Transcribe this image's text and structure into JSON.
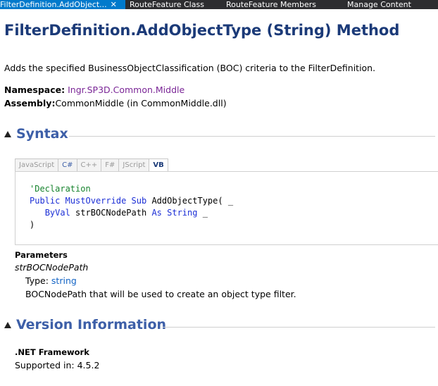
{
  "tabs": [
    {
      "label": "FilterDefinition.AddObject...",
      "active": true,
      "close": "✕"
    },
    {
      "label": "RouteFeature Class",
      "active": false
    },
    {
      "label": "RouteFeature Members",
      "active": false
    },
    {
      "label": "Manage Content",
      "active": false
    }
  ],
  "page": {
    "title": "FilterDefinition.AddObjectType (String) Method",
    "summary": "Adds the specified BusinessObjectClassification (BOC) criteria to the FilterDefinition.",
    "namespace_label": "Namespace:",
    "namespace_value": "Ingr.SP3D.Common.Middle",
    "assembly_label": "Assembly:",
    "assembly_value": "CommonMiddle (in CommonMiddle.dll)"
  },
  "syntax": {
    "heading": "Syntax",
    "languages": [
      "JavaScript",
      "C#",
      "C++",
      "F#",
      "JScript",
      "VB"
    ],
    "selected": "VB",
    "code": {
      "comment": "'Declaration",
      "kw_public": "Public",
      "kw_mustoverride": "MustOverride",
      "kw_sub": "Sub",
      "method_sig": "AddObjectType( _",
      "kw_byval": "ByVal",
      "param": "strBOCNodePath",
      "kw_as": "As",
      "kw_string": "String",
      "continuation": "_",
      "close": ")"
    }
  },
  "parameters": {
    "heading": "Parameters",
    "name": "strBOCNodePath",
    "type_label": "Type:",
    "type_value": "string",
    "description": "BOCNodePath that will be used to create an object type filter."
  },
  "version": {
    "heading": "Version Information",
    "framework_label": ".NET Framework",
    "supported": "Supported in: 4.5.2"
  },
  "colors": {
    "tab_active": "#007acc",
    "tabbar_bg": "#2d2d30",
    "title": "#1b3a78",
    "section_title": "#3d5fa8",
    "keyword": "#1c2fd6",
    "comment": "#16832d",
    "namespace_link": "#7a2596"
  }
}
